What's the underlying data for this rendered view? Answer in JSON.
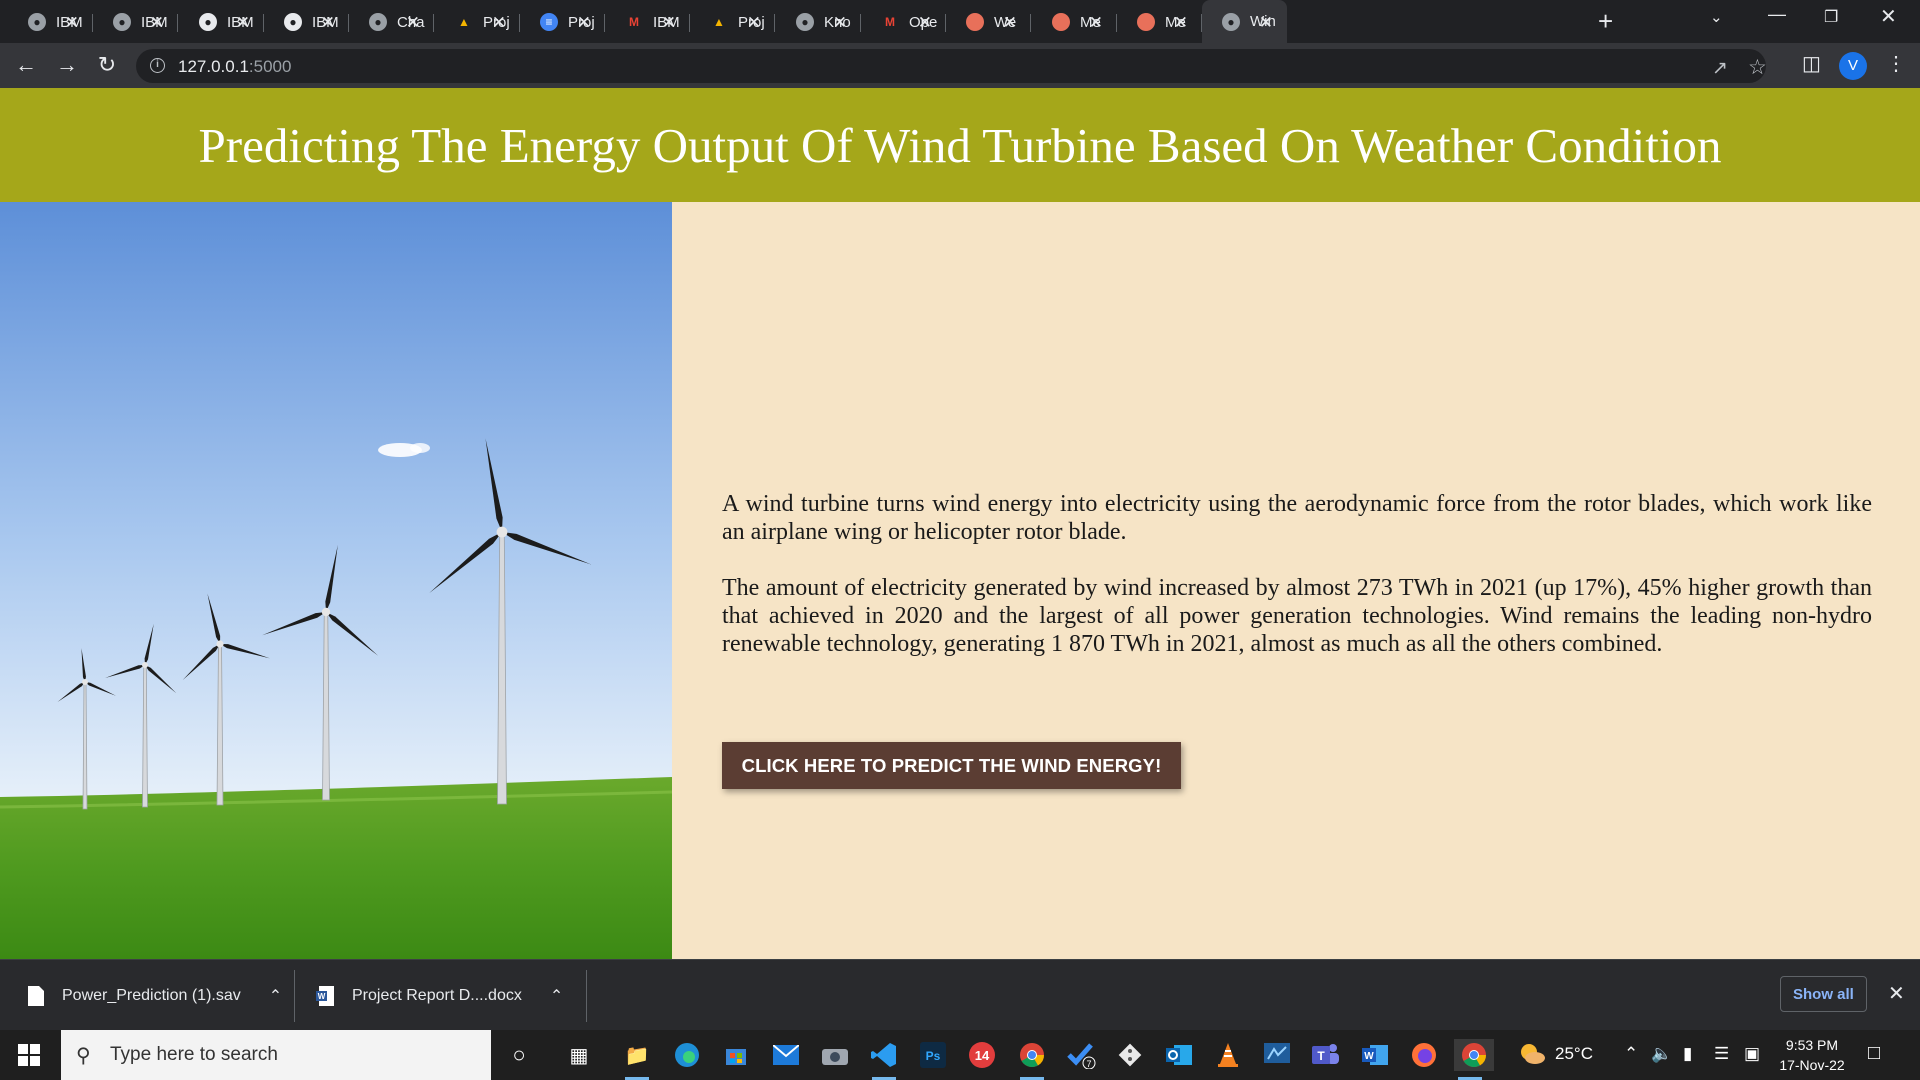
{
  "browser": {
    "tabs": [
      {
        "label": "IBM",
        "icon": "globe-icon"
      },
      {
        "label": "IBM",
        "icon": "globe-icon"
      },
      {
        "label": "IBM",
        "icon": "github-icon"
      },
      {
        "label": "IBM",
        "icon": "github-icon"
      },
      {
        "label": "Cha",
        "icon": "globe-icon"
      },
      {
        "label": "Proj",
        "icon": "google-drive-icon"
      },
      {
        "label": "Proj",
        "icon": "google-docs-icon"
      },
      {
        "label": "IBM",
        "icon": "gmail-icon"
      },
      {
        "label": "Proj",
        "icon": "google-drive-icon"
      },
      {
        "label": "Kno",
        "icon": "globe-icon"
      },
      {
        "label": "Ope",
        "icon": "gmail-icon"
      },
      {
        "label": "We",
        "icon": "helmet-icon"
      },
      {
        "label": "Me",
        "icon": "helmet-icon"
      },
      {
        "label": "Me",
        "icon": "helmet-icon"
      },
      {
        "label": "Win",
        "icon": "globe-icon",
        "active": true
      }
    ],
    "url_host": "127.0.0.1",
    "url_port": ":5000",
    "profile_initial": "V"
  },
  "page": {
    "title": "Predicting The Energy Output Of Wind Turbine Based On Weather Condition",
    "paragraph1": "A wind turbine turns wind energy into electricity using the aerodynamic force from the rotor blades, which work like an airplane wing or helicopter rotor blade.",
    "paragraph2": "The amount of electricity generated by wind increased by almost 273 TWh in 2021 (up 17%), 45% higher growth than that achieved in 2020 and the largest of all power generation technologies. Wind remains the leading non-hydro renewable technology, generating 1 870 TWh in 2021, almost as much as all the others combined.",
    "button_label": "CLICK HERE TO PREDICT THE WIND ENERGY!",
    "colors": {
      "header": "#a5a71a",
      "background": "#f6e4c6",
      "button": "#5b3d33"
    }
  },
  "downloads": {
    "items": [
      {
        "name": "Power_Prediction (1).sav"
      },
      {
        "name": "Project Report D....docx"
      }
    ],
    "show_all": "Show all"
  },
  "taskbar": {
    "search_placeholder": "Type here to search",
    "weather": "25°C",
    "time": "9:53 PM",
    "date": "17-Nov-22",
    "badge_count": "14",
    "todo_count": "7"
  }
}
